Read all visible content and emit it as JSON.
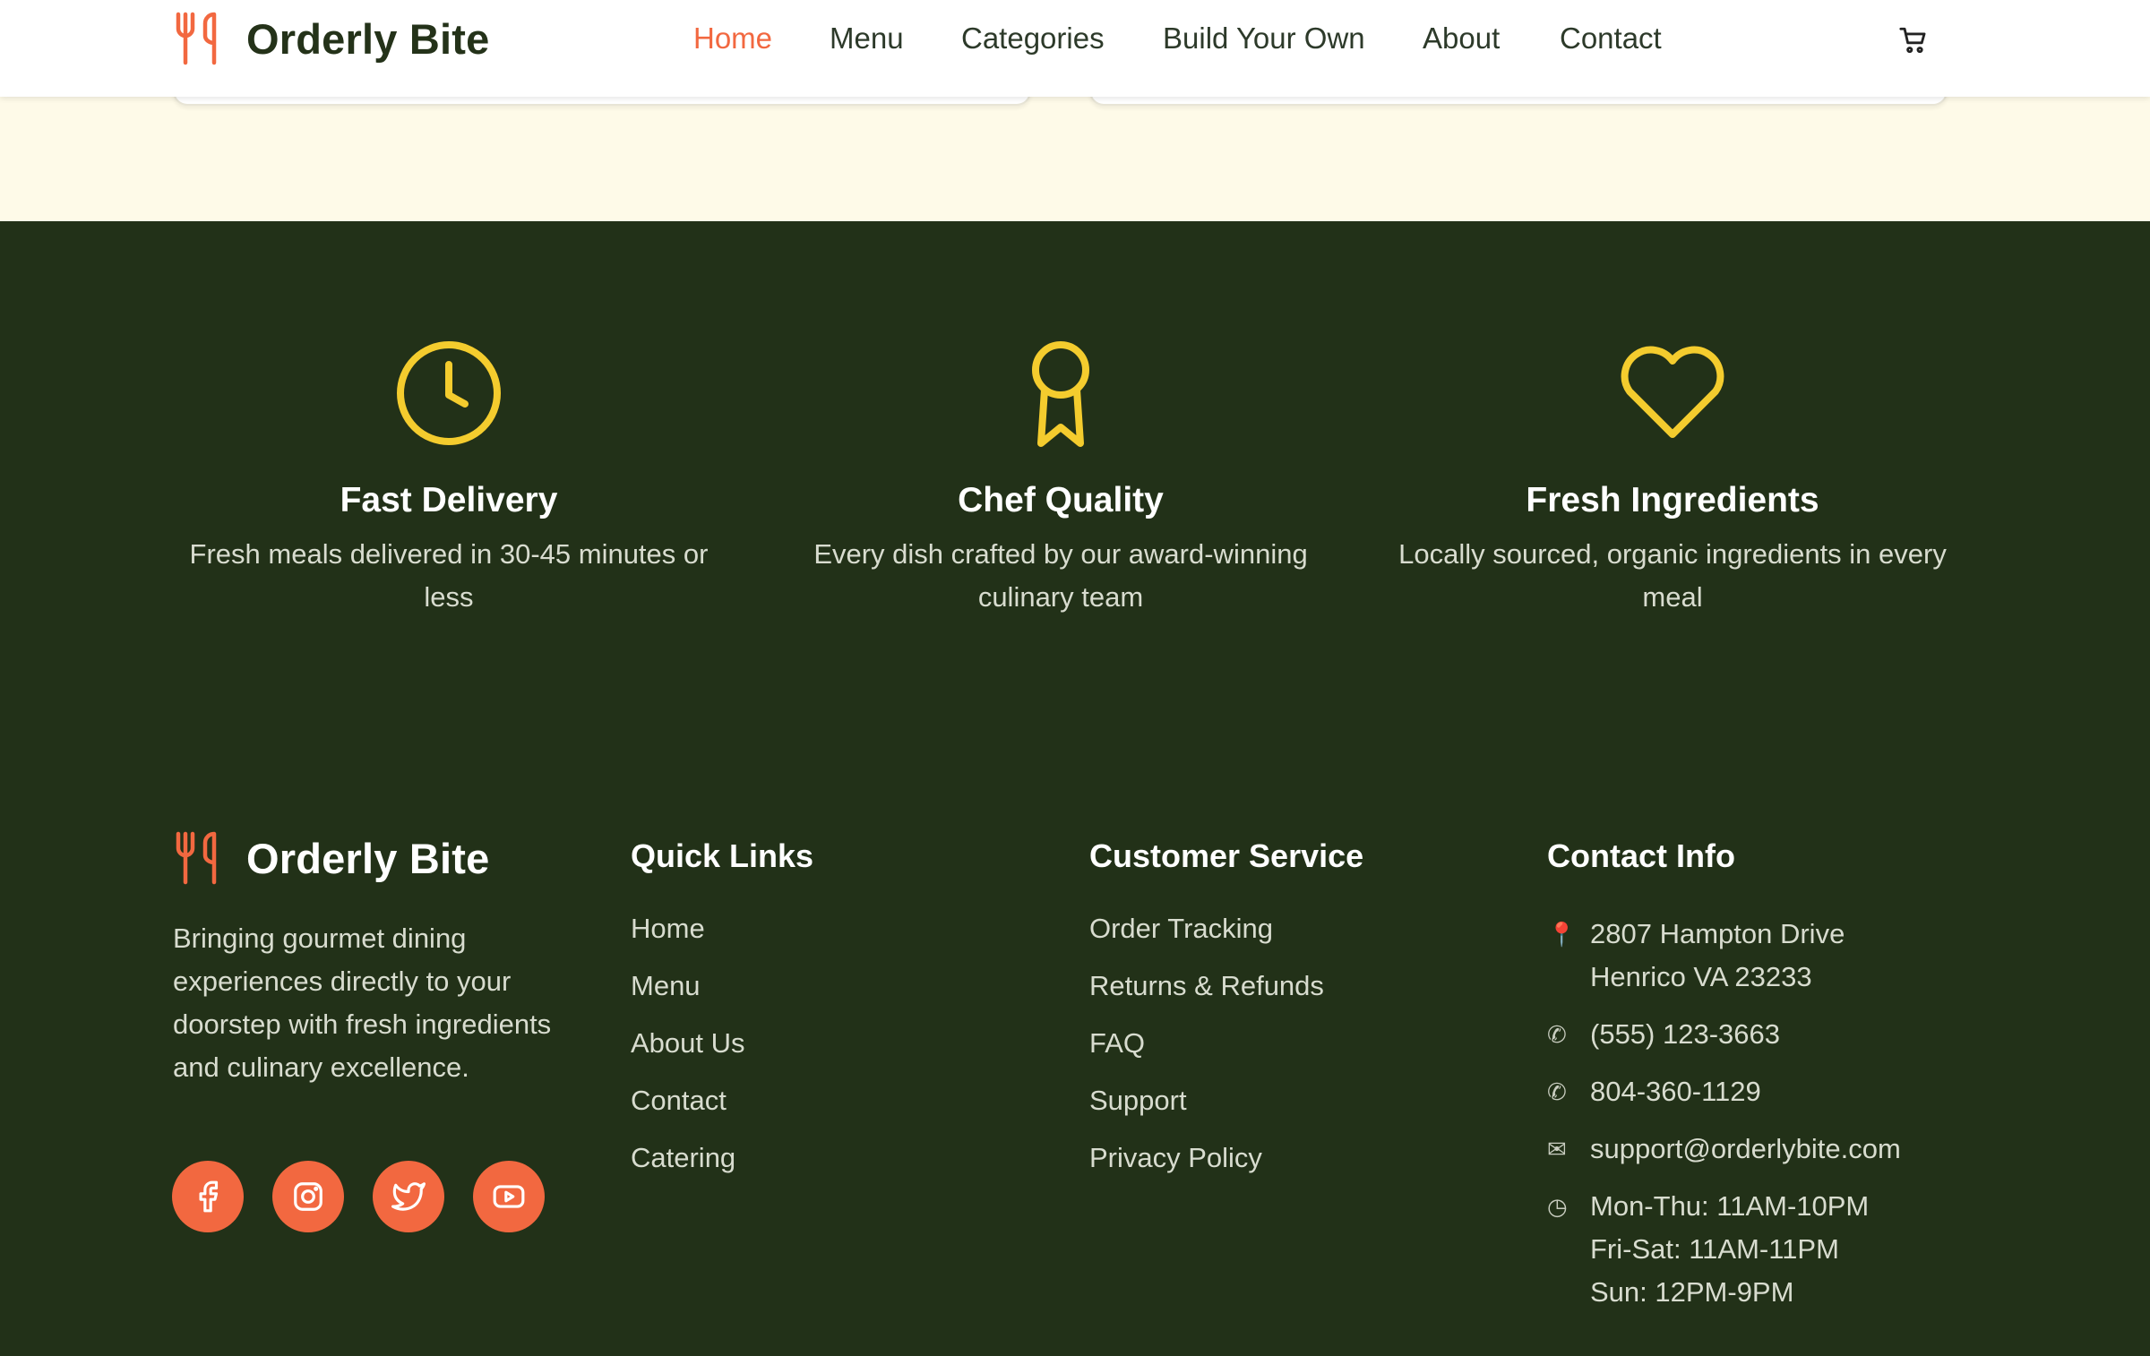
{
  "brand": {
    "name": "Orderly Bite",
    "accent": "#f26840",
    "dark_green": "#223118",
    "icon_yellow": "#f4cc2e"
  },
  "nav": {
    "items": [
      {
        "label": "Home",
        "active": true
      },
      {
        "label": "Menu"
      },
      {
        "label": "Categories"
      },
      {
        "label": "Build Your Own"
      },
      {
        "label": "About"
      },
      {
        "label": "Contact"
      }
    ],
    "cart_icon": "cart-icon"
  },
  "features": [
    {
      "icon": "clock-icon",
      "title": "Fast Delivery",
      "desc": "Fresh meals delivered in 30-45 minutes or less"
    },
    {
      "icon": "award-icon",
      "title": "Chef Quality",
      "desc": "Every dish crafted by our award-winning culinary team"
    },
    {
      "icon": "heart-icon",
      "title": "Fresh Ingredients",
      "desc": "Locally sourced, organic ingredients in every meal"
    }
  ],
  "footer": {
    "brand_name": "Orderly Bite",
    "about": "Bringing gourmet dining experiences directly to your doorstep with fresh ingredients and culinary excellence.",
    "socials": [
      "facebook-icon",
      "instagram-icon",
      "twitter-icon",
      "youtube-icon"
    ],
    "quick_links": {
      "title": "Quick Links",
      "items": [
        "Home",
        "Menu",
        "About Us",
        "Contact",
        "Catering"
      ]
    },
    "customer_service": {
      "title": "Customer Service",
      "items": [
        "Order Tracking",
        "Returns & Refunds",
        "FAQ",
        "Support",
        "Privacy Policy"
      ]
    },
    "contact": {
      "title": "Contact Info",
      "address": [
        "2807 Hampton Drive",
        "Henrico VA 23233"
      ],
      "phone1": "(555) 123-3663",
      "phone2": "804-360-1129",
      "email": "support@orderlybite.com",
      "hours": [
        "Mon-Thu: 11AM-10PM",
        "Fri-Sat: 11AM-11PM",
        "Sun: 12PM-9PM"
      ]
    }
  }
}
